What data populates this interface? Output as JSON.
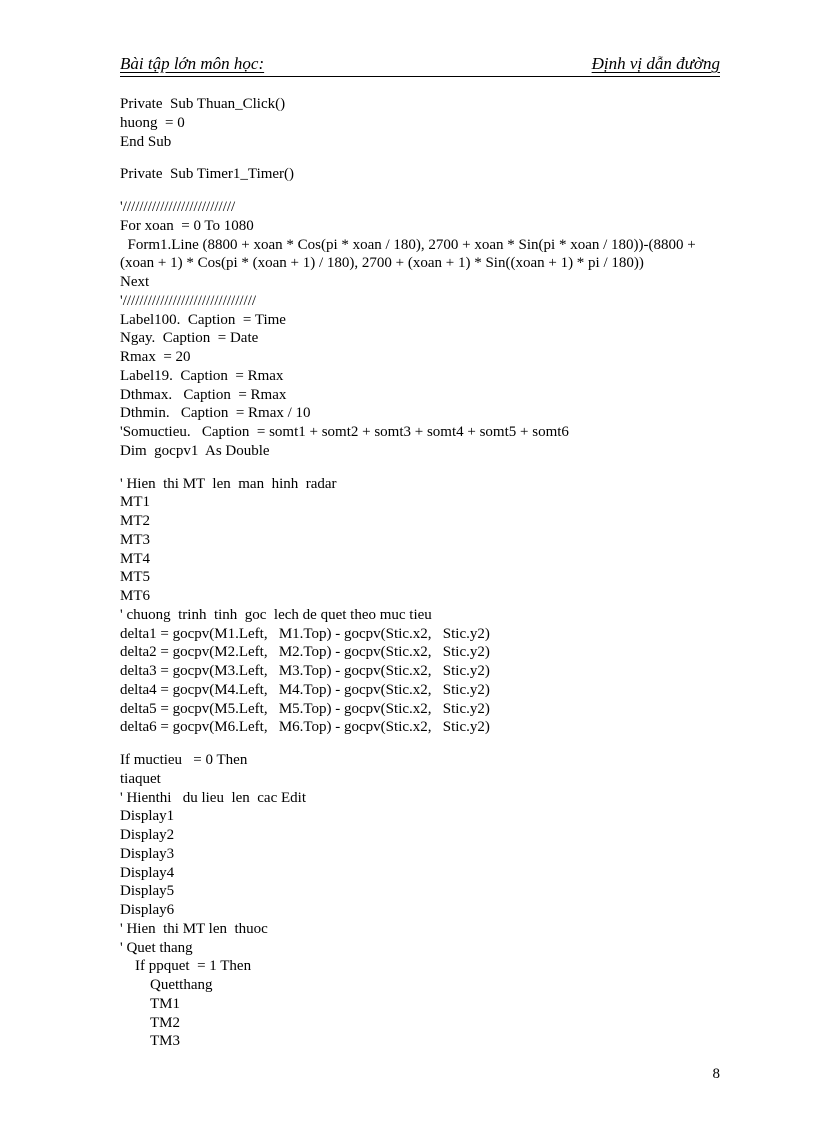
{
  "header": {
    "left": "Bài tập lớn môn học:",
    "right": "Định vị dẫn đường"
  },
  "body": {
    "block1": "Private  Sub Thuan_Click()\nhuong  = 0\nEnd Sub",
    "block2": "Private  Sub Timer1_Timer()",
    "block3": "'///////////////////////////\nFor xoan  = 0 To 1080\n  Form1.Line (8800 + xoan * Cos(pi * xoan / 180), 2700 + xoan * Sin(pi * xoan / 180))-(8800 + (xoan + 1) * Cos(pi * (xoan + 1) / 180), 2700 + (xoan + 1) * Sin((xoan + 1) * pi / 180))\nNext\n'////////////////////////////////\nLabel100.  Caption  = Time\nNgay.  Caption  = Date\nRmax  = 20\nLabel19.  Caption  = Rmax\nDthmax.   Caption  = Rmax\nDthmin.   Caption  = Rmax / 10\n'Somuctieu.   Caption  = somt1 + somt2 + somt3 + somt4 + somt5 + somt6\nDim  gocpv1  As Double",
    "block4": "' Hien  thi MT  len  man  hinh  radar\nMT1\nMT2\nMT3\nMT4\nMT5\nMT6\n' chuong  trinh  tinh  goc  lech de quet theo muc tieu\ndelta1 = gocpv(M1.Left,   M1.Top) - gocpv(Stic.x2,   Stic.y2)\ndelta2 = gocpv(M2.Left,   M2.Top) - gocpv(Stic.x2,   Stic.y2)\ndelta3 = gocpv(M3.Left,   M3.Top) - gocpv(Stic.x2,   Stic.y2)\ndelta4 = gocpv(M4.Left,   M4.Top) - gocpv(Stic.x2,   Stic.y2)\ndelta5 = gocpv(M5.Left,   M5.Top) - gocpv(Stic.x2,   Stic.y2)\ndelta6 = gocpv(M6.Left,   M6.Top) - gocpv(Stic.x2,   Stic.y2)",
    "block5": "If muctieu   = 0 Then\ntiaquet\n' Hienthi   du lieu  len  cac Edit\nDisplay1\nDisplay2\nDisplay3\nDisplay4\nDisplay5\nDisplay6\n' Hien  thi MT len  thuoc\n' Quet thang\n    If ppquet  = 1 Then\n        Quetthang\n        TM1\n        TM2\n        TM3"
  },
  "page_number": "8"
}
